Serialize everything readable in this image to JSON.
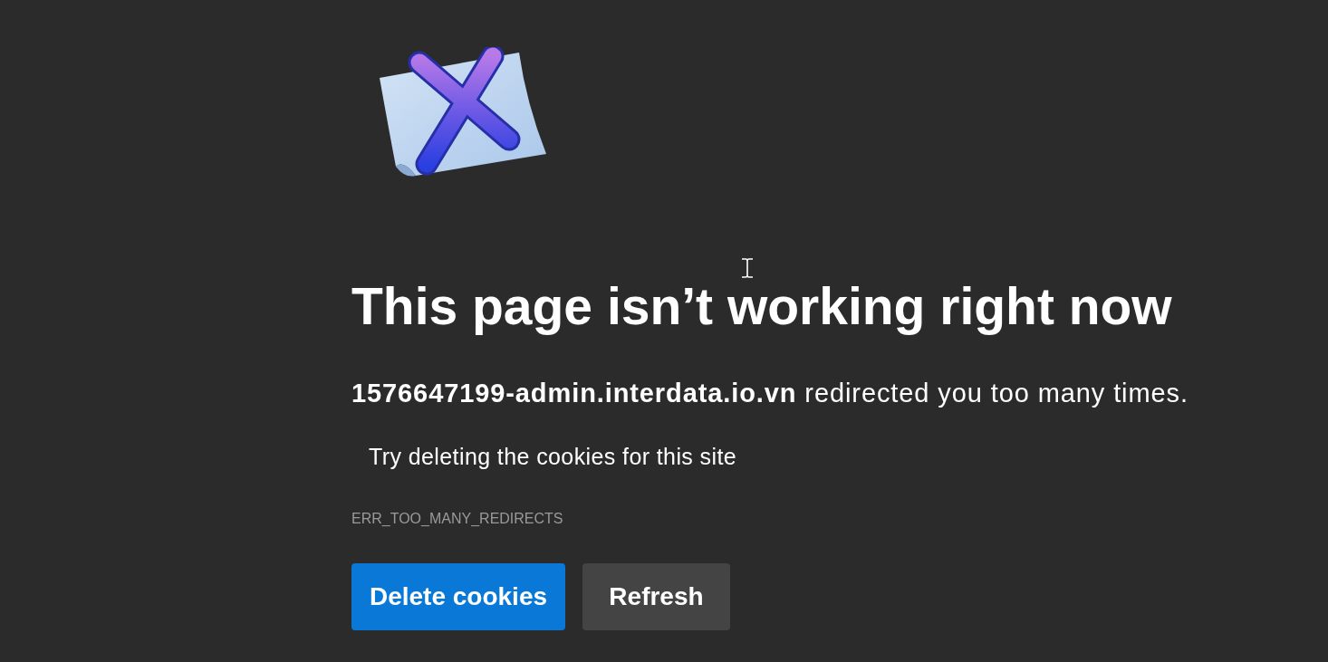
{
  "heading": "This page isn’t working right now",
  "message": "**1576647199-admin.interdata.io.vn** redirected you too many times.",
  "suggestions": [
    "Try deleting the cookies for this site"
  ],
  "error_code": "ERR_TOO_MANY_REDIRECTS",
  "buttons": [
    {
      "label": "Delete cookies",
      "kind": "primary"
    },
    {
      "label": "Refresh",
      "kind": "secondary"
    }
  ]
}
